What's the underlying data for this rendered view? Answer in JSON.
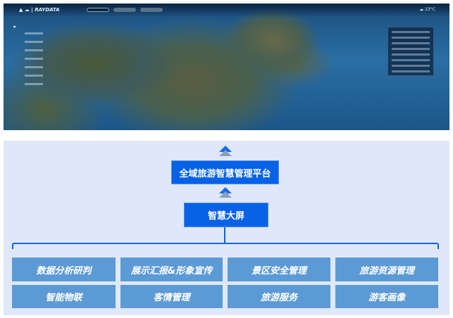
{
  "screenshot": {
    "brand": "RAYDATA",
    "weather": "23°C",
    "nav_tabs": [
      "",
      "",
      ""
    ],
    "icons": [
      "logo-icon",
      "cloud-icon"
    ]
  },
  "diagram": {
    "platform": "全域旅游智慧管理平台",
    "screen": "智慧大屏",
    "modules": [
      [
        "数据分析研判",
        "展示汇报&形象宣传",
        "景区安全管理",
        "旅游资源管理"
      ],
      [
        "智能物联",
        "客情管理",
        "旅游服务",
        "游客画像"
      ]
    ],
    "colors": {
      "primary": "#0862e6",
      "module": "#5c9ad6",
      "background": "#dfe8f8"
    }
  }
}
